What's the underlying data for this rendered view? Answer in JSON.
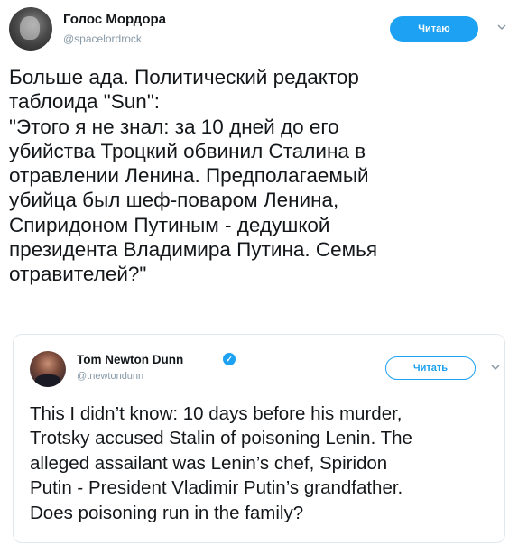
{
  "tweet": {
    "author_name": "Голос Мордора",
    "author_handle": "@spacelordrock",
    "follow_label": "Читаю",
    "text": "Больше ада. Политический редактор\nтаблоида \"Sun\":\n\"Этого я не знал: за 10 дней до его\nубийства Троцкий обвинил Сталина в\nотравлении Ленина. Предполагаемый\nубийца был шеф-поваром Ленина,\nСпиридоном Путиным - дедушкой\nпрезидента Владимира Путина. Семья\nотравителей?\""
  },
  "quoted_tweet": {
    "author_name": "Tom Newton Dunn",
    "author_handle": "@tnewtondunn",
    "follow_label": "Читать",
    "text": "This I didn’t know: 10 days before his murder,\nTrotsky accused Stalin of poisoning Lenin. The\nalleged assailant was Lenin’s chef, Spiridon\nPutin - President Vladimir Putin’s grandfather.\nDoes poisoning run in the family?"
  },
  "icons": {
    "verified": "verified-badge-icon",
    "chevron": "chevron-down-icon"
  },
  "colors": {
    "accent": "#1da1f2",
    "secondary_text": "#8899a6",
    "border": "#e1e8ed"
  }
}
